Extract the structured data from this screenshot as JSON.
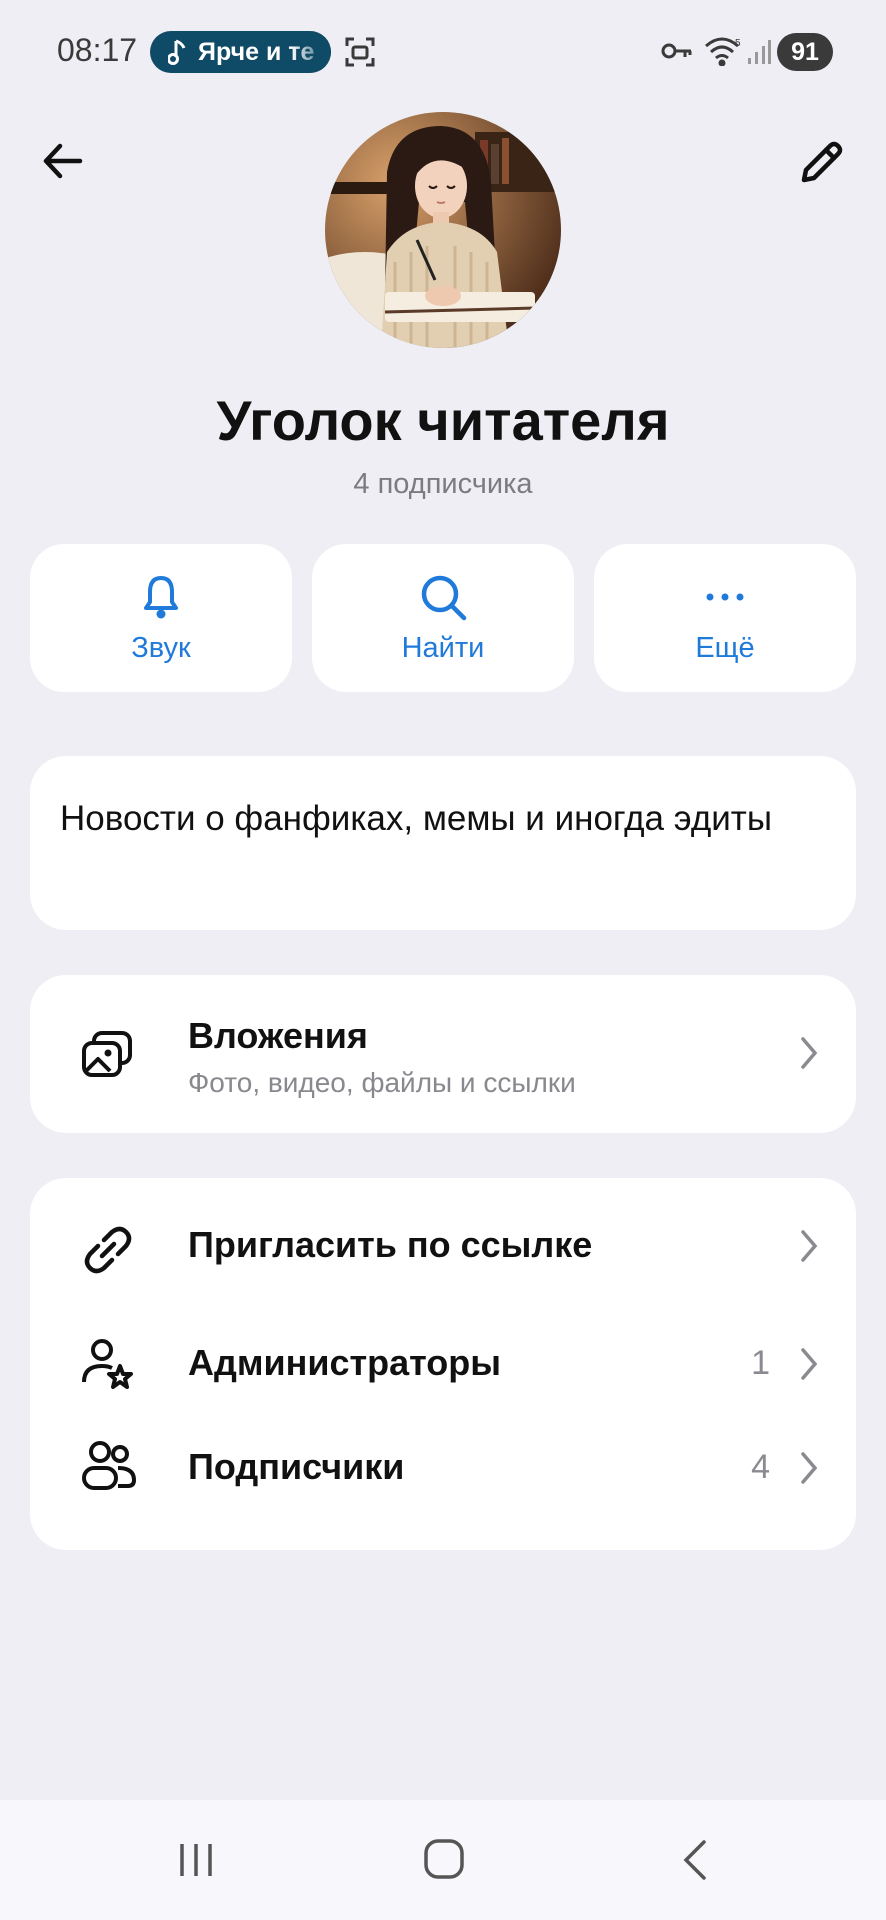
{
  "status_bar": {
    "time": "08:17",
    "music_text": "Ярче и те",
    "battery": "91"
  },
  "header": {
    "back_icon": "arrow-left-icon",
    "edit_icon": "pencil-icon"
  },
  "channel": {
    "title": "Уголок читателя",
    "subscribers": "4 подписчика",
    "description": "Новости о фанфиках, мемы и иногда эдиты"
  },
  "actions": [
    {
      "label": "Звук",
      "icon": "bell-icon"
    },
    {
      "label": "Найти",
      "icon": "search-icon"
    },
    {
      "label": "Ещё",
      "icon": "more-icon"
    }
  ],
  "attachments": {
    "title": "Вложения",
    "subtitle": "Фото, видео, файлы и ссылки"
  },
  "list": [
    {
      "label": "Пригласить по ссылке",
      "count": "",
      "icon": "link-icon"
    },
    {
      "label": "Администраторы",
      "count": "1",
      "icon": "admin-star-icon"
    },
    {
      "label": "Подписчики",
      "count": "4",
      "icon": "users-icon"
    }
  ],
  "colors": {
    "accent": "#1f7ad9",
    "background": "#eeeef4",
    "card": "#ffffff"
  }
}
